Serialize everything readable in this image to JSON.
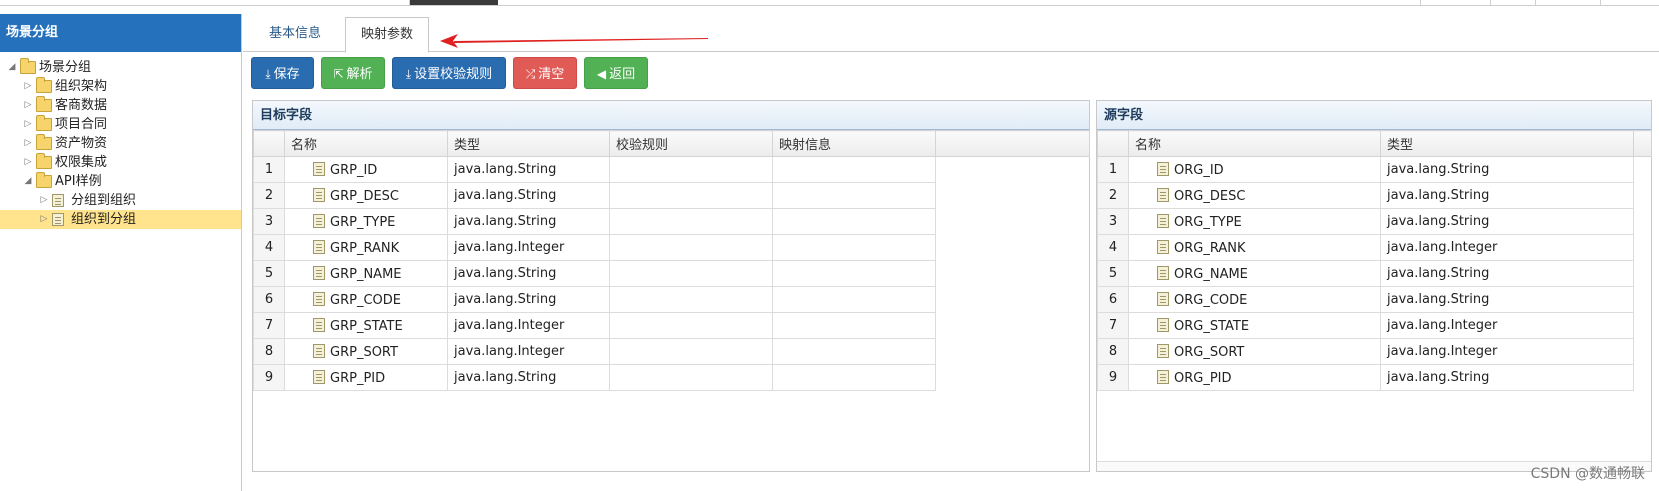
{
  "left_panel": {
    "title": "场景分组",
    "tree": [
      {
        "label": "场景分组",
        "level": 0,
        "expanded": true,
        "type": "folder"
      },
      {
        "label": "组织架构",
        "level": 1,
        "expanded": false,
        "type": "folder"
      },
      {
        "label": "客商数据",
        "level": 1,
        "expanded": false,
        "type": "folder"
      },
      {
        "label": "项目合同",
        "level": 1,
        "expanded": false,
        "type": "folder"
      },
      {
        "label": "资产物资",
        "level": 1,
        "expanded": false,
        "type": "folder"
      },
      {
        "label": "权限集成",
        "level": 1,
        "expanded": false,
        "type": "folder"
      },
      {
        "label": "API样例",
        "level": 1,
        "expanded": true,
        "type": "folder"
      },
      {
        "label": "分组到组织",
        "level": 2,
        "expanded": false,
        "type": "file"
      },
      {
        "label": "组织到分组",
        "level": 2,
        "expanded": false,
        "type": "file",
        "selected": true
      }
    ]
  },
  "tabs": {
    "basic": "基本信息",
    "mapping": "映射参数"
  },
  "toolbar": {
    "save": "保存",
    "parse": "解析",
    "rules": "设置校验规则",
    "clear": "清空",
    "back": "返回"
  },
  "target": {
    "title": "目标字段",
    "columns": [
      "名称",
      "类型",
      "校验规则",
      "映射信息"
    ],
    "rows": [
      {
        "no": "1",
        "name": "GRP_ID",
        "type": "java.lang.String",
        "rule": "",
        "map": ""
      },
      {
        "no": "2",
        "name": "GRP_DESC",
        "type": "java.lang.String",
        "rule": "",
        "map": ""
      },
      {
        "no": "3",
        "name": "GRP_TYPE",
        "type": "java.lang.String",
        "rule": "",
        "map": ""
      },
      {
        "no": "4",
        "name": "GRP_RANK",
        "type": "java.lang.Integer",
        "rule": "",
        "map": ""
      },
      {
        "no": "5",
        "name": "GRP_NAME",
        "type": "java.lang.String",
        "rule": "",
        "map": ""
      },
      {
        "no": "6",
        "name": "GRP_CODE",
        "type": "java.lang.String",
        "rule": "",
        "map": ""
      },
      {
        "no": "7",
        "name": "GRP_STATE",
        "type": "java.lang.Integer",
        "rule": "",
        "map": ""
      },
      {
        "no": "8",
        "name": "GRP_SORT",
        "type": "java.lang.Integer",
        "rule": "",
        "map": ""
      },
      {
        "no": "9",
        "name": "GRP_PID",
        "type": "java.lang.String",
        "rule": "",
        "map": ""
      }
    ]
  },
  "source": {
    "title": "源字段",
    "columns": [
      "名称",
      "类型"
    ],
    "rows": [
      {
        "no": "1",
        "name": "ORG_ID",
        "type": "java.lang.String"
      },
      {
        "no": "2",
        "name": "ORG_DESC",
        "type": "java.lang.String"
      },
      {
        "no": "3",
        "name": "ORG_TYPE",
        "type": "java.lang.String"
      },
      {
        "no": "4",
        "name": "ORG_RANK",
        "type": "java.lang.Integer"
      },
      {
        "no": "5",
        "name": "ORG_NAME",
        "type": "java.lang.String"
      },
      {
        "no": "6",
        "name": "ORG_CODE",
        "type": "java.lang.String"
      },
      {
        "no": "7",
        "name": "ORG_STATE",
        "type": "java.lang.Integer"
      },
      {
        "no": "8",
        "name": "ORG_SORT",
        "type": "java.lang.Integer"
      },
      {
        "no": "9",
        "name": "ORG_PID",
        "type": "java.lang.String"
      }
    ]
  },
  "watermark": "CSDN @数通畅联",
  "icons": {
    "tree_folder": "folder-icon",
    "tree_file": "file-icon",
    "save": "download-icon",
    "parse": "parse-icon",
    "rules": "rules-icon",
    "clear": "shuffle-icon",
    "back": "arrow-left-icon"
  },
  "colors": {
    "header_blue": "#2671bc",
    "btn_blue": "#2a6cb0",
    "btn_green": "#52b155",
    "btn_red": "#e05a56",
    "selected": "#ffe48d",
    "annotation_arrow": "#e02020"
  }
}
